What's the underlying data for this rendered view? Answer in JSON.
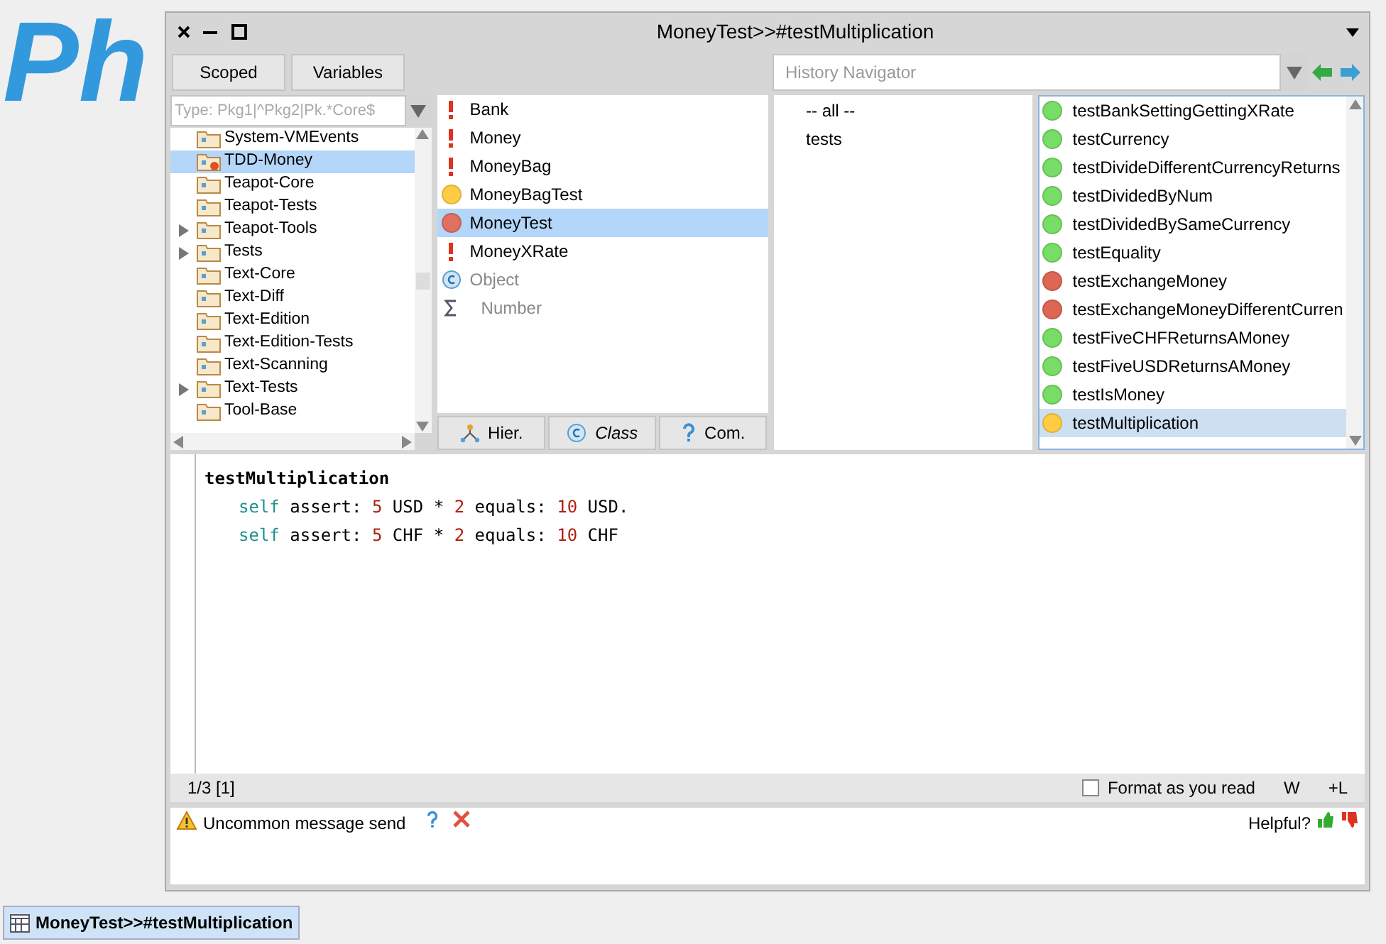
{
  "logo": "Ph",
  "window": {
    "title": "MoneyTest>>#testMultiplication"
  },
  "toolbar": {
    "buttons": [
      "Scoped",
      "Variables"
    ],
    "history_placeholder": "History Navigator"
  },
  "packages": {
    "filter_placeholder": "Type: Pkg1|^Pkg2|Pk.*Core$",
    "items": [
      {
        "label": "System-VMEvents",
        "expandable": false,
        "selected": false,
        "kind": "package"
      },
      {
        "label": "TDD-Money",
        "expandable": false,
        "selected": true,
        "kind": "extended"
      },
      {
        "label": "Teapot-Core",
        "expandable": false,
        "selected": false,
        "kind": "package"
      },
      {
        "label": "Teapot-Tests",
        "expandable": false,
        "selected": false,
        "kind": "package"
      },
      {
        "label": "Teapot-Tools",
        "expandable": true,
        "selected": false,
        "kind": "package"
      },
      {
        "label": "Tests",
        "expandable": true,
        "selected": false,
        "kind": "package"
      },
      {
        "label": "Text-Core",
        "expandable": false,
        "selected": false,
        "kind": "package"
      },
      {
        "label": "Text-Diff",
        "expandable": false,
        "selected": false,
        "kind": "package"
      },
      {
        "label": "Text-Edition",
        "expandable": false,
        "selected": false,
        "kind": "package"
      },
      {
        "label": "Text-Edition-Tests",
        "expandable": false,
        "selected": false,
        "kind": "package"
      },
      {
        "label": "Text-Scanning",
        "expandable": false,
        "selected": false,
        "kind": "package"
      },
      {
        "label": "Text-Tests",
        "expandable": true,
        "selected": false,
        "kind": "package"
      },
      {
        "label": "Tool-Base",
        "expandable": false,
        "selected": false,
        "kind": "package"
      }
    ]
  },
  "classes": {
    "items": [
      {
        "label": "Bank",
        "kind": "error",
        "selected": false
      },
      {
        "label": "Money",
        "kind": "error",
        "selected": false
      },
      {
        "label": "MoneyBag",
        "kind": "error",
        "selected": false
      },
      {
        "label": "MoneyBagTest",
        "kind": "pending",
        "selected": false
      },
      {
        "label": "MoneyTest",
        "kind": "failing",
        "selected": true
      },
      {
        "label": "MoneyXRate",
        "kind": "error",
        "selected": false
      },
      {
        "label": "Object",
        "kind": "superclass",
        "selected": false
      },
      {
        "label": "Number",
        "kind": "trait",
        "selected": false
      }
    ],
    "mode_buttons": [
      {
        "label": "Hier.",
        "kind": "hierarchy",
        "selected": false
      },
      {
        "label": "Class",
        "kind": "class",
        "selected": true
      },
      {
        "label": "Com.",
        "kind": "comment",
        "selected": false
      }
    ]
  },
  "protocols": [
    {
      "label": "-- all --",
      "selected": false
    },
    {
      "label": "tests",
      "selected": false
    }
  ],
  "methods": [
    {
      "label": "testBankSettingGettingXRate",
      "color": "#77dd66",
      "selected": false
    },
    {
      "label": "testCurrency",
      "color": "#77dd66",
      "selected": false
    },
    {
      "label": "testDivideDifferentCurrencyReturns",
      "color": "#77dd66",
      "selected": false
    },
    {
      "label": "testDividedByNum",
      "color": "#77dd66",
      "selected": false
    },
    {
      "label": "testDividedBySameCurrency",
      "color": "#77dd66",
      "selected": false
    },
    {
      "label": "testEquality",
      "color": "#77dd66",
      "selected": false
    },
    {
      "label": "testExchangeMoney",
      "color": "#dd6655",
      "selected": false
    },
    {
      "label": "testExchangeMoneyDifferentCurren",
      "color": "#dd6655",
      "selected": false
    },
    {
      "label": "testFiveCHFReturnsAMoney",
      "color": "#77dd66",
      "selected": false
    },
    {
      "label": "testFiveUSDReturnsAMoney",
      "color": "#77dd66",
      "selected": false
    },
    {
      "label": "testIsMoney",
      "color": "#77dd66",
      "selected": false
    },
    {
      "label": "testMultiplication",
      "color": "#ffcc44",
      "selected": true
    }
  ],
  "code": [
    {
      "kind": "selector",
      "tokens": [
        {
          "text": "testMultiplication",
          "kind": "plain"
        }
      ]
    },
    {
      "kind": "statement",
      "tokens": [
        {
          "text": "self",
          "kind": "keyword"
        },
        {
          "text": "assert:",
          "kind": "plain"
        },
        {
          "text": "5",
          "kind": "number"
        },
        {
          "text": "USD",
          "kind": "plain"
        },
        {
          "text": "*",
          "kind": "plain"
        },
        {
          "text": "2",
          "kind": "number"
        },
        {
          "text": "equals:",
          "kind": "plain"
        },
        {
          "text": "10",
          "kind": "number"
        },
        {
          "text": "USD.",
          "kind": "plain"
        }
      ]
    },
    {
      "kind": "statement",
      "tokens": [
        {
          "text": "self",
          "kind": "keyword"
        },
        {
          "text": "assert:",
          "kind": "plain"
        },
        {
          "text": "5",
          "kind": "number"
        },
        {
          "text": "CHF",
          "kind": "plain"
        },
        {
          "text": "*",
          "kind": "plain"
        },
        {
          "text": "2",
          "kind": "number"
        },
        {
          "text": "equals:",
          "kind": "plain"
        },
        {
          "text": "10",
          "kind": "number"
        },
        {
          "text": "CHF",
          "kind": "plain"
        }
      ]
    }
  ],
  "status_bar": {
    "position": "1/3 [1]",
    "format_label": "Format as you read",
    "format_checked": false,
    "wrap": "W",
    "line_numbers": "+L"
  },
  "critic": {
    "message": "Uncommon message send",
    "helpful": "Helpful?"
  },
  "taskbar": [
    {
      "label": "MoneyTest>>#testMultiplication",
      "selected": true
    }
  ]
}
